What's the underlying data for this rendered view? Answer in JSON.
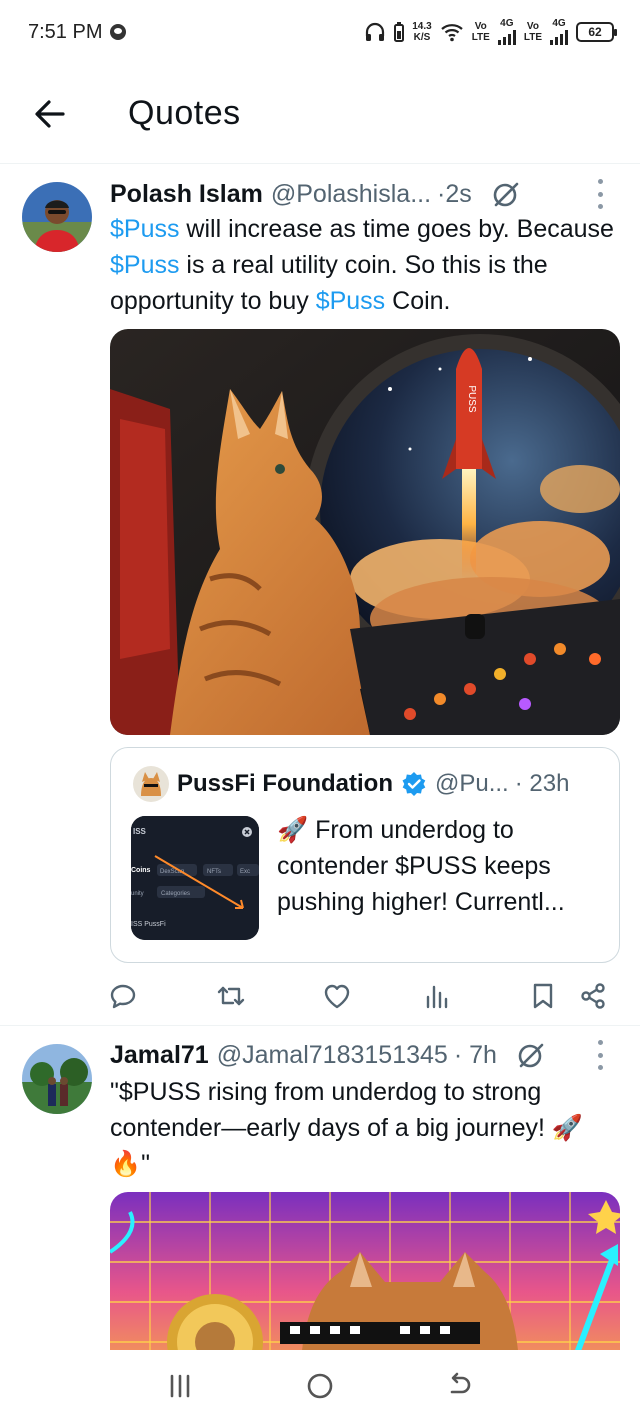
{
  "status_bar": {
    "time": "7:51 PM",
    "net_speed_value": "14.3",
    "net_speed_unit": "K/S",
    "sim1_top": "Vo",
    "sim1_bottom": "LTE",
    "sim1_gen": "4G",
    "sim2_top": "Vo",
    "sim2_bottom": "LTE",
    "sim2_gen": "4G",
    "battery": "62"
  },
  "header": {
    "title": "Quotes"
  },
  "tweets": [
    {
      "name": "Polash Islam",
      "handle": "@Polashisla...",
      "time": "·2s",
      "text_parts": [
        "$Puss",
        " will increase as time goes by. Because ",
        "$Puss",
        " is a real utility coin. So this is the opportunity to buy ",
        "$Puss",
        " Coin."
      ],
      "media_rocket_text": "PUSS",
      "quote": {
        "name": "PussFi Foundation",
        "handle": "@Pu...",
        "time": "· 23h",
        "text": "🚀 From underdog to contender  $PUSS keeps pushing higher! Currentl...",
        "thumb_labels": {
          "top": "ISS",
          "tab1": "Coins",
          "tab2": "DexScan",
          "tab3": "NFTs",
          "tab4": "Exc",
          "tab5": "unity",
          "tab6": "Categories",
          "bottom": "ISS PussFi"
        }
      }
    },
    {
      "name": "Jamal71",
      "handle": "@Jamal7183151345",
      "time": "· 7h",
      "text": "\"$PUSS rising from underdog to strong contender—early days of a big journey! 🚀🔥\""
    }
  ],
  "colors": {
    "accent": "#1d9bf0",
    "text": "#0f1419",
    "secondary": "#536471"
  }
}
